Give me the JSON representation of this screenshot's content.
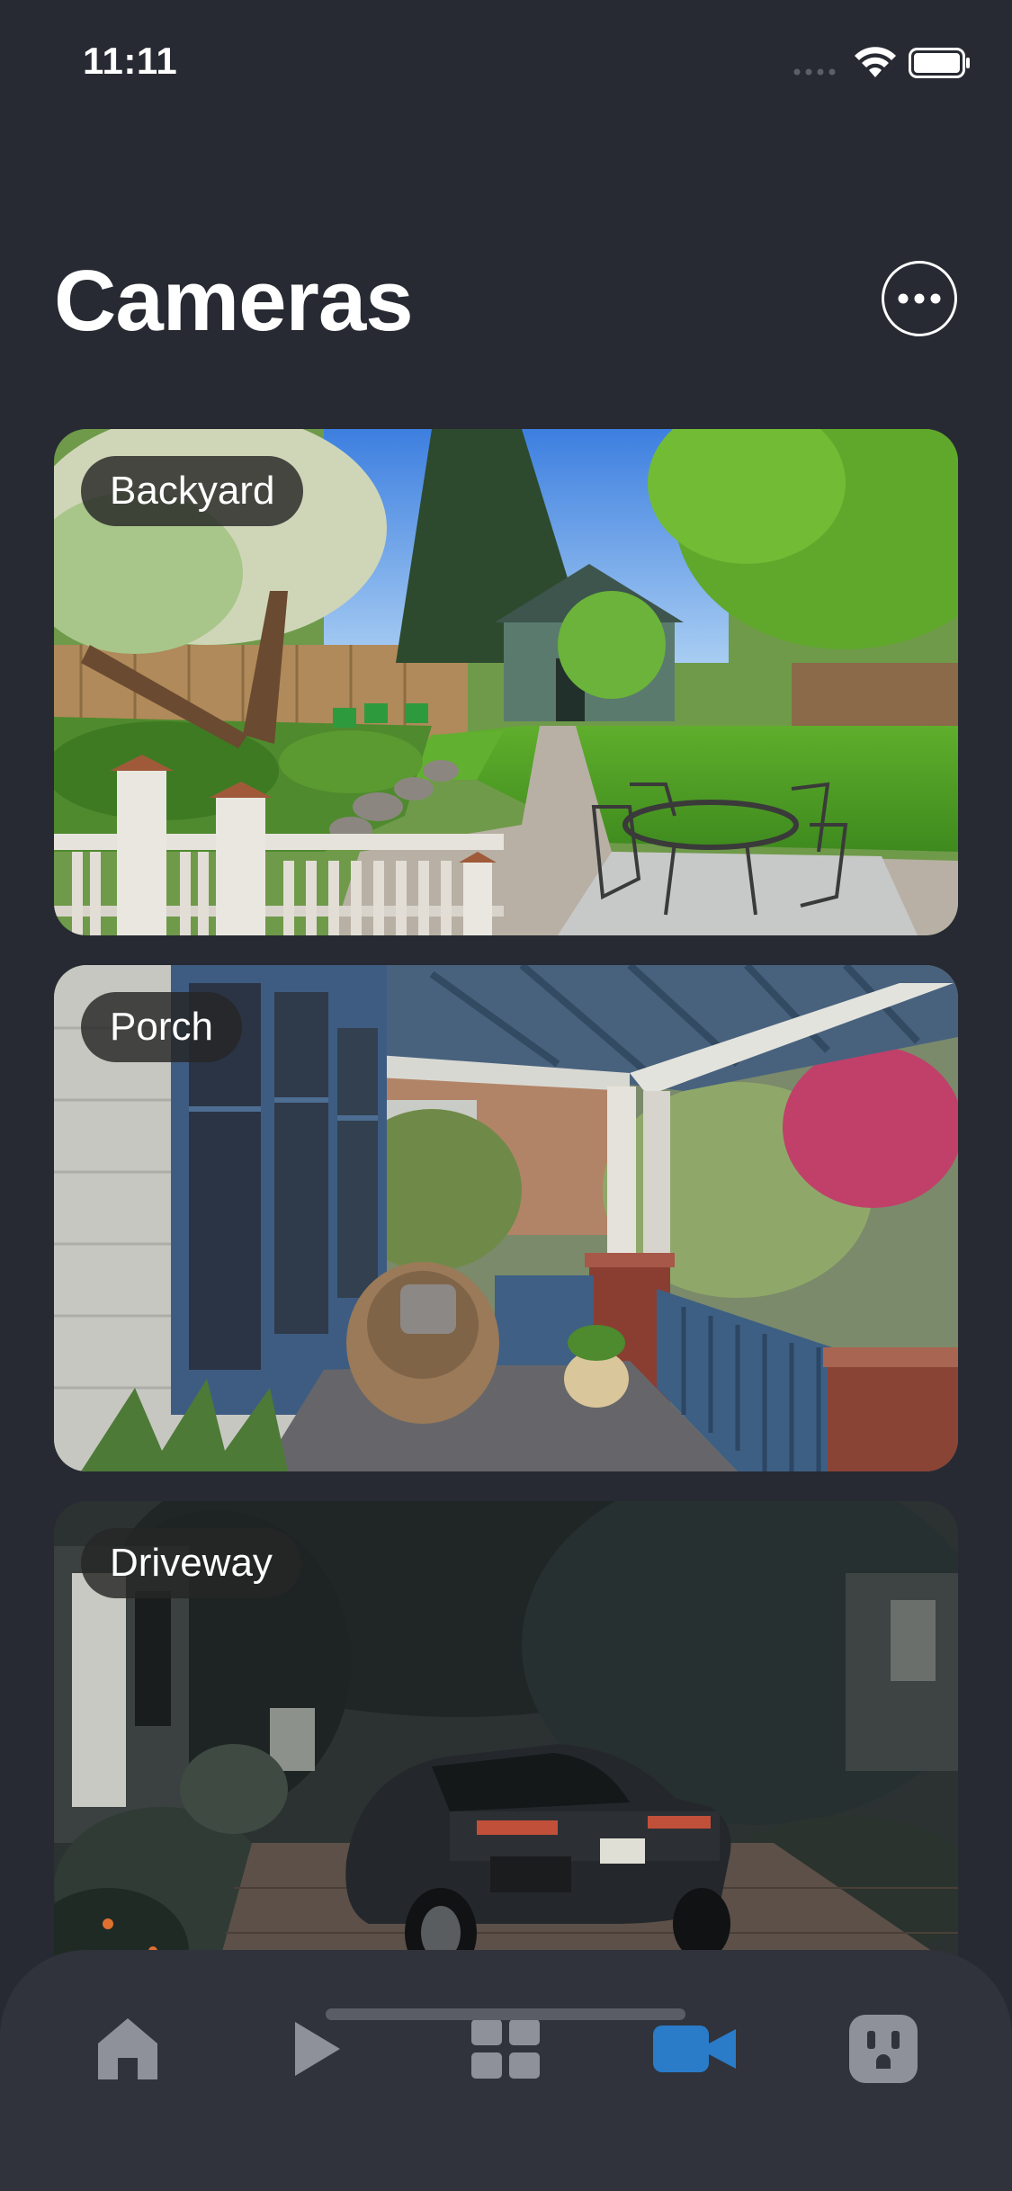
{
  "status_bar": {
    "time": "11:11",
    "icons": [
      "signal-dots-icon",
      "wifi-icon",
      "battery-icon"
    ]
  },
  "header": {
    "title": "Cameras",
    "more_icon": "ellipsis-circle-icon"
  },
  "cameras": [
    {
      "label": "Backyard"
    },
    {
      "label": "Porch"
    },
    {
      "label": "Driveway"
    }
  ],
  "tab_bar": {
    "items": [
      {
        "name": "home",
        "icon": "home-icon",
        "active": false
      },
      {
        "name": "play",
        "icon": "play-icon",
        "active": false
      },
      {
        "name": "grid",
        "icon": "grid-icon",
        "active": false
      },
      {
        "name": "cameras",
        "icon": "video-camera-icon",
        "active": true
      },
      {
        "name": "outlet",
        "icon": "power-outlet-icon",
        "active": false
      }
    ],
    "active_color": "#2a7bc8",
    "inactive_color": "#8e919a"
  },
  "colors": {
    "background": "#272a32",
    "tab_bar": "#30333b",
    "label_pill": "#262626"
  }
}
